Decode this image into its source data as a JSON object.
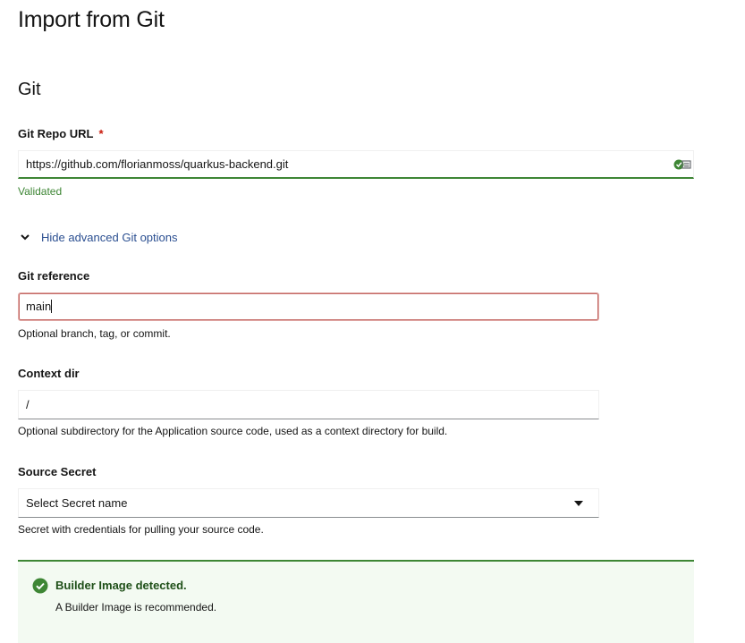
{
  "page": {
    "title": "Import from Git"
  },
  "git_section": {
    "title": "Git",
    "repo_url": {
      "label": "Git Repo URL",
      "required_marker": "*",
      "value": "https://github.com/florianmoss/quarkus-backend.git",
      "validation": "Validated"
    },
    "advanced_toggle": {
      "label": "Hide advanced Git options",
      "expanded": true
    },
    "git_reference": {
      "label": "Git reference",
      "value": "main",
      "helper": "Optional branch, tag, or commit."
    },
    "context_dir": {
      "label": "Context dir",
      "value": "/",
      "helper": "Optional subdirectory for the Application source code, used as a context directory for build."
    },
    "source_secret": {
      "label": "Source Secret",
      "selected": "Select Secret name",
      "helper": "Secret with credentials for pulling your source code."
    }
  },
  "alert": {
    "title": "Builder Image detected.",
    "body": "A Builder Image is recommended.",
    "status": "success"
  },
  "colors": {
    "success": "#3e8635",
    "error": "#c9190b",
    "link": "#2b4f91",
    "alert_bg": "#f3faf2"
  }
}
